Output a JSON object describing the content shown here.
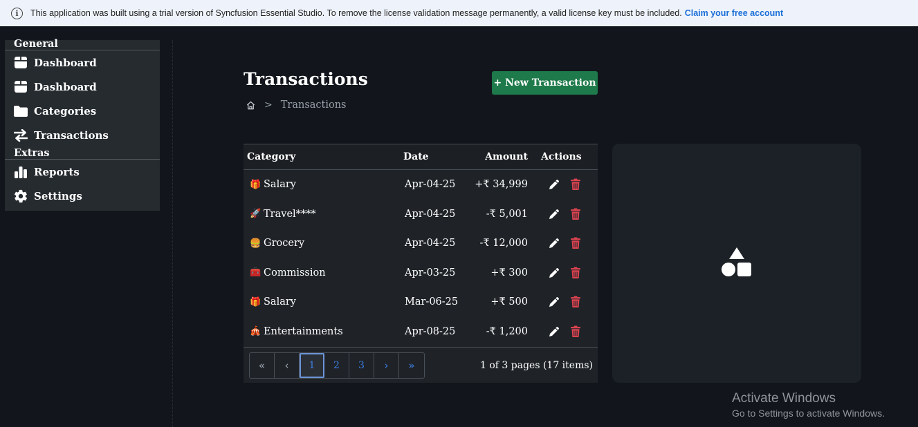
{
  "license_banner": {
    "message": "This application was built using a trial version of Syncfusion Essential Studio. To remove the license validation message permanently, a valid license key must be included.",
    "link_text": "Claim your free account",
    "icon": "info-icon"
  },
  "sidebar": {
    "sections": [
      {
        "title": "General",
        "items": [
          {
            "label": "Dashboard",
            "icon": "dashboard-icon"
          },
          {
            "label": "Dashboard",
            "icon": "dashboard-icon"
          },
          {
            "label": "Categories",
            "icon": "folder-icon"
          },
          {
            "label": "Transactions",
            "icon": "arrows-exchange-icon"
          }
        ]
      },
      {
        "title": "Extras",
        "items": [
          {
            "label": "Reports",
            "icon": "bar-chart-icon"
          },
          {
            "label": "Settings",
            "icon": "gear-icon"
          }
        ]
      }
    ]
  },
  "page": {
    "title": "Transactions",
    "new_button": "+ New Transaction",
    "breadcrumb": {
      "current": "Transactions"
    }
  },
  "grid": {
    "columns": [
      "Category",
      "Date",
      "Amount",
      "Actions"
    ],
    "rows": [
      {
        "emoji": "🎁",
        "category": "Salary",
        "date": "Apr-04-25",
        "amount": "+₹ 34,999"
      },
      {
        "emoji": "🚀",
        "category": "Travel****",
        "date": "Apr-04-25",
        "amount": "-₹ 5,001"
      },
      {
        "emoji": "🍔",
        "category": "Grocery",
        "date": "Apr-04-25",
        "amount": "-₹ 12,000"
      },
      {
        "emoji": "🧰",
        "category": "Commission",
        "date": "Apr-03-25",
        "amount": "+₹ 300"
      },
      {
        "emoji": "🎁",
        "category": "Salary",
        "date": "Mar-06-25",
        "amount": "+₹ 500"
      },
      {
        "emoji": "🎪",
        "category": "Entertainments",
        "date": "Apr-08-25",
        "amount": "-₹ 1,200"
      }
    ],
    "pager": {
      "first": "«",
      "prev": "‹",
      "pages": [
        "1",
        "2",
        "3"
      ],
      "current_page": "1",
      "next": "›",
      "last": "»",
      "info": "1 of 3 pages (17 items)"
    }
  },
  "chart_placeholder": {
    "icon": "shapes-icon"
  },
  "watermark": {
    "title": "Activate Windows",
    "subtitle": "Go to Settings to activate Windows."
  },
  "colors": {
    "background": "#12161c",
    "sidebar": "#262b30",
    "accent_green": "#1e7a4a",
    "delete_red": "#d9434f",
    "pager_blue": "#3d7de0"
  }
}
